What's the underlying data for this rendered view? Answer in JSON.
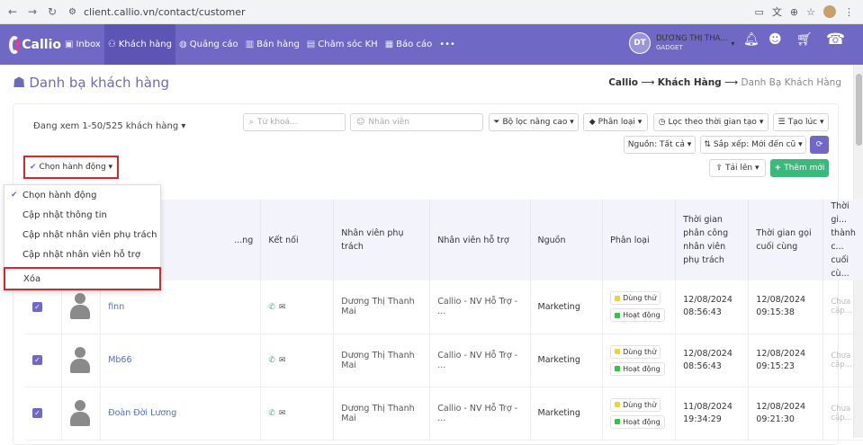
{
  "browser": {
    "url": "client.callio.vn/contact/customer"
  },
  "brand": {
    "logo_text": "Callio"
  },
  "nav": {
    "items": [
      {
        "label": "Inbox",
        "icon": "inbox-icon"
      },
      {
        "label": "Khách hàng",
        "icon": "users-icon"
      },
      {
        "label": "Quảng cáo",
        "icon": "globe-icon"
      },
      {
        "label": "Bán hàng",
        "icon": "chart-icon"
      },
      {
        "label": "Chăm sóc KH",
        "icon": "chat-icon"
      },
      {
        "label": "Báo cáo",
        "icon": "folder-icon"
      }
    ],
    "more": "•••"
  },
  "user": {
    "initials": "DT",
    "name": "DƯƠNG THỊ THA...",
    "role": "GADGET"
  },
  "page": {
    "title": "Danh bạ khách hàng",
    "breadcrumb": [
      "Callio",
      "Khách Hàng",
      "Danh Bạ Khách Hàng"
    ],
    "breadcrumb_sep": "⟶"
  },
  "toolbar": {
    "viewing": "Đang xem 1-50/525 khách hàng",
    "keyword_placeholder": "Từ khoá...",
    "staff_placeholder": "Nhân viên",
    "advanced_filter": "Bộ lọc nâng cao",
    "category": "Phân loại",
    "time_filter": "Lọc theo thời gian tạo",
    "created_at": "Tạo lúc",
    "source": "Nguồn: Tất cả",
    "sort": "Sắp xếp: Mới đến cũ",
    "upload": "Tải lên",
    "add_new": "Thêm mới",
    "action_select": "Chọn hành động"
  },
  "dropdown": {
    "items": [
      "Chọn hành động",
      "Cập nhật thông tin",
      "Cập nhật nhân viên phụ trách",
      "Cập nhật nhân viên hỗ trợ",
      "Xóa"
    ]
  },
  "table": {
    "headers": [
      "",
      "",
      "...ng",
      "Kết nối",
      "Nhân viên phụ trách",
      "Nhân viên hỗ trợ",
      "Nguồn",
      "Phân loại",
      "Thời gian phân công nhân viên phụ trách",
      "Thời gian gọi cuối cùng",
      "Thời gi... thành c... cuối cù..."
    ],
    "tags": {
      "trial": "Dùng thử",
      "active": "Hoạt động"
    },
    "rows": [
      {
        "name": "finn",
        "owner": "Dương Thị Thanh Mai",
        "support": "Callio - NV Hỗ Trợ - ...",
        "source": "Marketing",
        "assigned_date": "12/08/2024",
        "assigned_time": "08:56:43",
        "last_call_date": "12/08/2024",
        "last_call_time": "09:15:38",
        "last_success": "Chưa cập..."
      },
      {
        "name": "Mb66",
        "owner": "Dương Thị Thanh Mai",
        "support": "Callio - NV Hỗ Trợ - ...",
        "source": "Marketing",
        "assigned_date": "12/08/2024",
        "assigned_time": "08:56:43",
        "last_call_date": "12/08/2024",
        "last_call_time": "09:15:23",
        "last_success": "Chưa cập..."
      },
      {
        "name": "Đoàn Đời Lương",
        "owner": "Dương Thị Thanh Mai",
        "support": "Callio - NV Hỗ Trợ - ...",
        "source": "Marketing",
        "assigned_date": "11/08/2024",
        "assigned_time": "19:34:29",
        "last_call_date": "12/08/2024",
        "last_call_time": "09:21:30",
        "last_success": "Chưa cập..."
      }
    ]
  },
  "colors": {
    "primary": "#6f68c4",
    "green": "#3bb97a",
    "highlight": "#d9262c",
    "trial": "#f2d23c",
    "active": "#2bc840"
  }
}
